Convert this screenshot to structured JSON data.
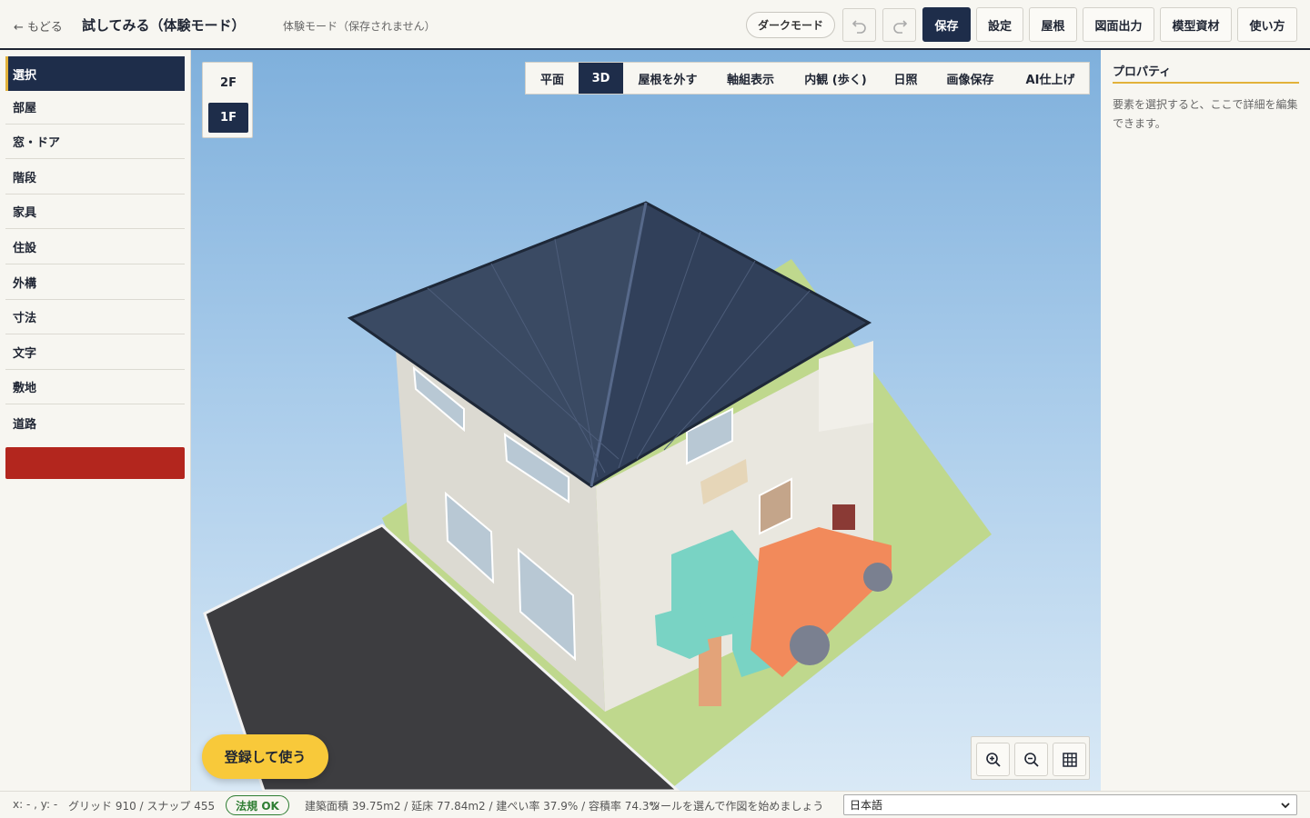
{
  "header": {
    "back_label": "← もどる",
    "title": "試してみる（体験モード）",
    "mode_note": "体験モード（保存されません）",
    "dark_mode_label": "ダークモード",
    "undo_icon": "undo-icon",
    "redo_icon": "redo-icon",
    "buttons": [
      "保存",
      "設定",
      "屋根",
      "図面出力",
      "模型資材",
      "使い方"
    ]
  },
  "sidebar": {
    "tools": [
      "選択",
      "部屋",
      "窓・ドア",
      "階段",
      "家具",
      "住設",
      "外構",
      "寸法",
      "文字",
      "敷地",
      "道路"
    ],
    "active_tool": "選択",
    "accent_color": "#e2b23b",
    "danger_color": "#b3261e"
  },
  "viewport": {
    "floors": [
      "2F",
      "1F"
    ],
    "active_floor": "1F",
    "view_toolbar": [
      "平面",
      "3D",
      "屋根を外す",
      "軸組表示",
      "内観 (歩く)",
      "日照",
      "画像保存",
      "AI仕上げ"
    ],
    "active_view": "3D",
    "zoom_icons": [
      "zoom-in-icon",
      "zoom-out-icon",
      "grid-icon"
    ],
    "register_label": "登録して使う"
  },
  "properties": {
    "title": "プロパティ",
    "description": "要素を選択すると、ここで詳細を編集できます。"
  },
  "status": {
    "coords": "x: - , y: -",
    "grid": "グリッド 910 / スナップ 455",
    "legal_badge": "法規 OK",
    "stats": "建築面積 39.75m2 / 延床 77.84m2 / 建ぺい率 37.9% / 容積率 74.3%",
    "hint": "ツールを選んで作図を始めましょう",
    "language": "日本語"
  },
  "colors": {
    "navy": "#1e2d4a",
    "ok_green": "#2e7d32",
    "register_yellow": "#f8c93a"
  }
}
